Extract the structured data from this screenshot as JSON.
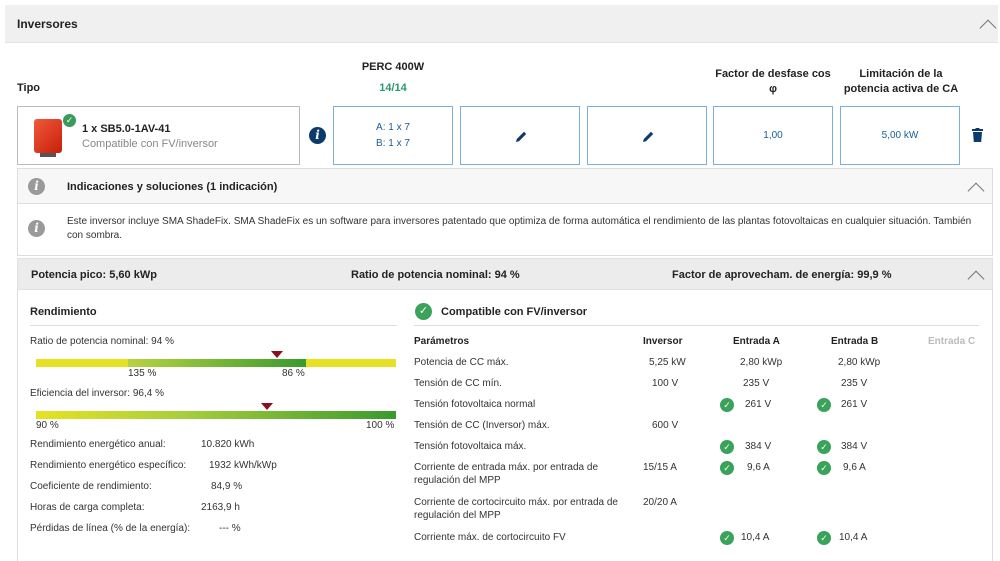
{
  "panel": {
    "title": "Inversores"
  },
  "header": {
    "tipo_label": "Tipo",
    "module_name": "PERC 400W",
    "module_count": "14/14",
    "cos_phi_label": "Factor de desfase cos φ",
    "ca_limit_label": "Limitación de la potencia activa de CA"
  },
  "inverter": {
    "name": "1 x SB5.0-1AV-41",
    "compat": "Compatible con FV/inversor",
    "strings_a": "A: 1 x 7",
    "strings_b": "B: 1 x 7",
    "cos_phi": "1,00",
    "ca_limit": "5,00 kW"
  },
  "notice": {
    "title": "Indicaciones y soluciones (1 indicación)",
    "body": "Este inversor incluye SMA ShadeFix. SMA ShadeFix es un software para inversores patentado que optimiza de forma automática el rendimiento de las plantas fotovoltaicas en cualquier situación. También con sombra."
  },
  "summary": {
    "peak": "Potencia pico: 5,60 kWp",
    "ratio": "Ratio de potencia nominal: 94 %",
    "factor": "Factor de aprovecham. de energía: 99,9 %"
  },
  "rendimiento": {
    "title": "Rendimiento",
    "ratio_label": "Ratio de potencia nominal: 94 %",
    "ratio_tick_low": "135 %",
    "ratio_tick_high": "86 %",
    "eff_label": "Eficiencia del inversor: 96,4 %",
    "eff_tick_low": "90 %",
    "eff_tick_high": "100 %",
    "rows": [
      {
        "label": "Rendimiento energético anual:",
        "value": "10.820 kWh"
      },
      {
        "label": "Rendimiento energético específico:",
        "value": "1932 kWh/kWp"
      },
      {
        "label": "Coeficiente de rendimiento:",
        "value": "84,9 %"
      },
      {
        "label": "Horas de carga completa:",
        "value": "2163,9 h"
      },
      {
        "label": "Pérdidas de línea (% de la energía):",
        "value": "--- %"
      }
    ]
  },
  "params": {
    "compat_title": "Compatible con FV/inversor",
    "headers": [
      "Parámetros",
      "Inversor",
      "Entrada A",
      "Entrada B",
      "Entrada C"
    ],
    "rows": [
      {
        "label": "Potencia de CC máx.",
        "inv": "5,25 kW",
        "a": "2,80 kWp",
        "b": "2,80 kWp"
      },
      {
        "label": "Tensión de CC mín.",
        "inv": "100 V",
        "a": "235 V",
        "b": "235 V"
      },
      {
        "label": "Tensión fotovoltaica normal",
        "inv": "",
        "a": "261 V",
        "b": "261 V"
      },
      {
        "label": "Tensión de CC (Inversor) máx.",
        "inv": "600 V",
        "a": "",
        "b": ""
      },
      {
        "label": "Tensión fotovoltaica máx.",
        "inv": "",
        "a": "384 V",
        "b": "384 V"
      },
      {
        "label1": "Corriente de entrada máx. por entrada de",
        "label2": "regulación del MPP",
        "inv": "15/15 A",
        "a": "9,6 A",
        "b": "9,6 A"
      },
      {
        "label1": "Corriente de cortocircuito máx. por entrada de",
        "label2": "regulación del MPP",
        "inv": "20/20 A",
        "a": "",
        "b": ""
      },
      {
        "label": "Corriente máx. de cortocircuito FV",
        "inv": "",
        "a": "10,4 A",
        "b": "10,4 A"
      }
    ]
  },
  "colors": {
    "accent": "#2a9a6a",
    "blue": "#1a5d96",
    "marker": "#8b0f1e"
  }
}
